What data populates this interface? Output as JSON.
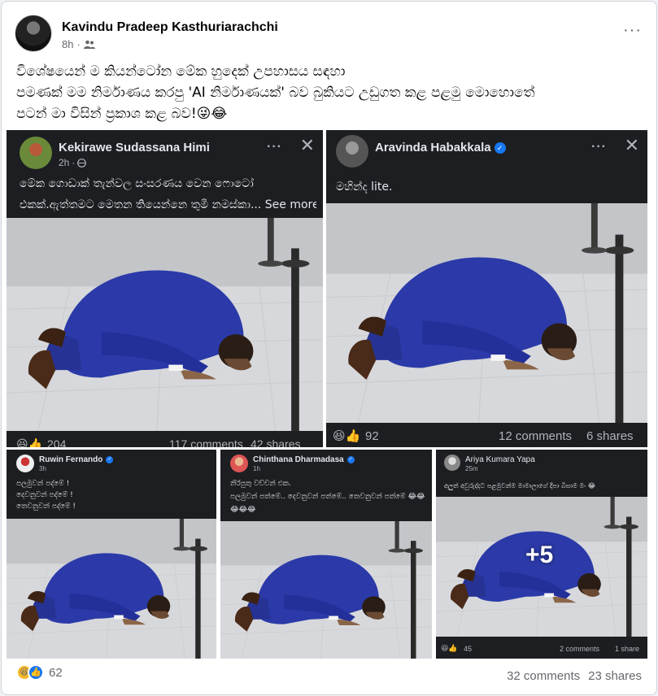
{
  "post": {
    "author": "Kavindu Pradeep Kasthuriarachchi",
    "time": "8h",
    "audience_icon": "friends-icon",
    "more_icon": "more-options-icon",
    "text_lines": [
      "විශේෂයෙන් ම කියන්ටෝන මේක හුදෙක් උපහාසය සඳහා",
      "පමණක් මම නිර්මාණය කරපු 'AI නිර්මාණයක්' බව බුකියට උඩුගත කළ පළමු මොහොතේ",
      "පටන් මා විසින් ප්‍රකාශ කළ බව!😜😂"
    ],
    "reactions_count": "62",
    "comments": "32 comments",
    "shares": "23 shares"
  },
  "shots": [
    {
      "name": "Kekirawe Sudassana Himi",
      "time": "2h",
      "text1": "මේක ගොඩාක් තැන්වල සංසරණය වෙන ෆොටෝ",
      "text2": "එකක්.ඇත්තමට මෙතන තියෙන්නෙ තුමී නමස්කා... See more",
      "reactions": "204",
      "comments": "117 comments",
      "shares": "42 shares"
    },
    {
      "name": "Aravinda Habakkala",
      "text1": "මහින්ද lite.",
      "reactions": "92",
      "comments": "12 comments",
      "shares": "6 shares"
    },
    {
      "name": "Ruwin Fernando",
      "time": "3h",
      "lines": [
        "පලමුවන් පද්මේ !",
        "දෙවනුවන් පද්මේ !",
        "තෙවනුවන් පද්මේ !"
      ]
    },
    {
      "name": "Chinthana Dharmadasa",
      "time": "1h",
      "lines": [
        "නිරිපුතු වච්චන් එක.",
        "පලමුවන් පත්මේ.. දෙවනුවන් පත්මේ.. තෙවනුවන් පත්මේ 😂😂",
        "😂😂😂"
      ]
    },
    {
      "name": "Ariya Kumara Yapa",
      "time": "25m",
      "lines": [
        "අලුත් අවුරුද්දට පළමුවන්ම මාමාලාගේ දීපා බිසාම මං 😂"
      ],
      "more_count": "+5",
      "reactions": "45",
      "comments": "2 comments",
      "shares": "1 share"
    }
  ],
  "colors": {
    "brand_blue": "#1877f2",
    "dark_card": "#1c1e21",
    "suit_blue": "#2b3aa8",
    "floor": "#d9dadc"
  }
}
